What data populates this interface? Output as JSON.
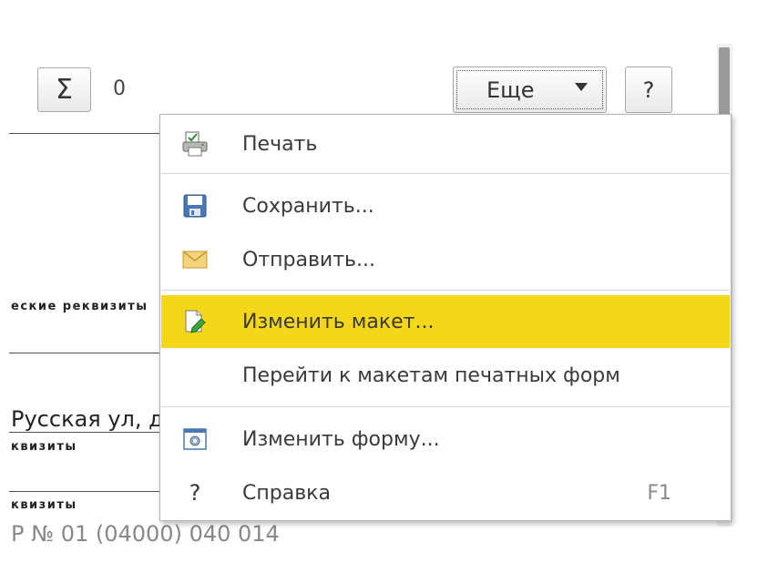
{
  "toolbar": {
    "sum_icon": "Σ",
    "sum_value": "0",
    "more_label": "Еще",
    "help_label": "?"
  },
  "background": {
    "requisites_1": "еские реквизиты",
    "address": "Русская ул, д",
    "requisites_2": "квизиты",
    "requisites_3": "квизиты",
    "bottom_text": "Р         № 01      (04000) 040 014"
  },
  "menu": {
    "items": [
      {
        "label": "Печать",
        "icon": "print-icon"
      },
      {
        "label": "Сохранить...",
        "icon": "save-icon"
      },
      {
        "label": "Отправить...",
        "icon": "envelope-icon"
      },
      {
        "label": "Изменить макет...",
        "icon": "edit-layout-icon",
        "highlighted": true
      },
      {
        "label": "Перейти к макетам печатных форм",
        "icon": ""
      },
      {
        "label": "Изменить форму...",
        "icon": "edit-form-icon"
      },
      {
        "label": "Справка",
        "icon": "help-icon",
        "icon_glyph": "?",
        "shortcut": "F1"
      }
    ]
  },
  "colors": {
    "highlight": "#f4d61a",
    "menu_border": "#b5b5b5",
    "separator": "#d4d4d4"
  }
}
